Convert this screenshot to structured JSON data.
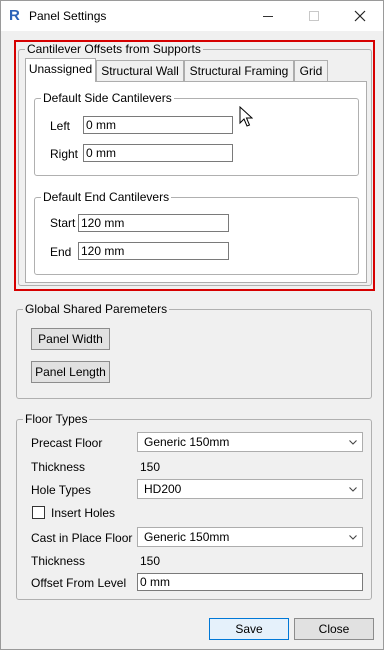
{
  "window": {
    "title": "Panel Settings",
    "icon": "revit-app-icon"
  },
  "cantilever": {
    "legend": "Cantilever Offsets from Supports",
    "tabs": [
      "Unassigned",
      "Structural Wall",
      "Structural Framing",
      "Grid"
    ],
    "active_tab": "Unassigned",
    "side": {
      "legend": "Default Side Cantilevers",
      "left_label": "Left",
      "left_value": "0 mm",
      "right_label": "Right",
      "right_value": "0 mm"
    },
    "end": {
      "legend": "Default End Cantilevers",
      "start_label": "Start",
      "start_value": "120 mm",
      "end_label": "End",
      "end_value": "120 mm"
    }
  },
  "global": {
    "legend": "Global Shared Paremeters",
    "panel_width": "Panel Width",
    "panel_length": "Panel Length"
  },
  "floor": {
    "legend": "Floor Types",
    "precast_label": "Precast Floor",
    "precast_value": "Generic 150mm",
    "thickness1_label": "Thickness",
    "thickness1_value": "150",
    "hole_label": "Hole Types",
    "hole_value": "HD200",
    "insert_holes_label": "Insert Holes",
    "insert_holes_checked": false,
    "cip_label": "Cast in Place Floor",
    "cip_value": "Generic 150mm",
    "thickness2_label": "Thickness",
    "thickness2_value": "150",
    "offset_label": "Offset From Level",
    "offset_value": "0 mm"
  },
  "footer": {
    "save": "Save",
    "close": "Close"
  },
  "colors": {
    "highlight_border": "#d60000",
    "accent": "#0078d7",
    "app_icon": "#2b62b8"
  }
}
